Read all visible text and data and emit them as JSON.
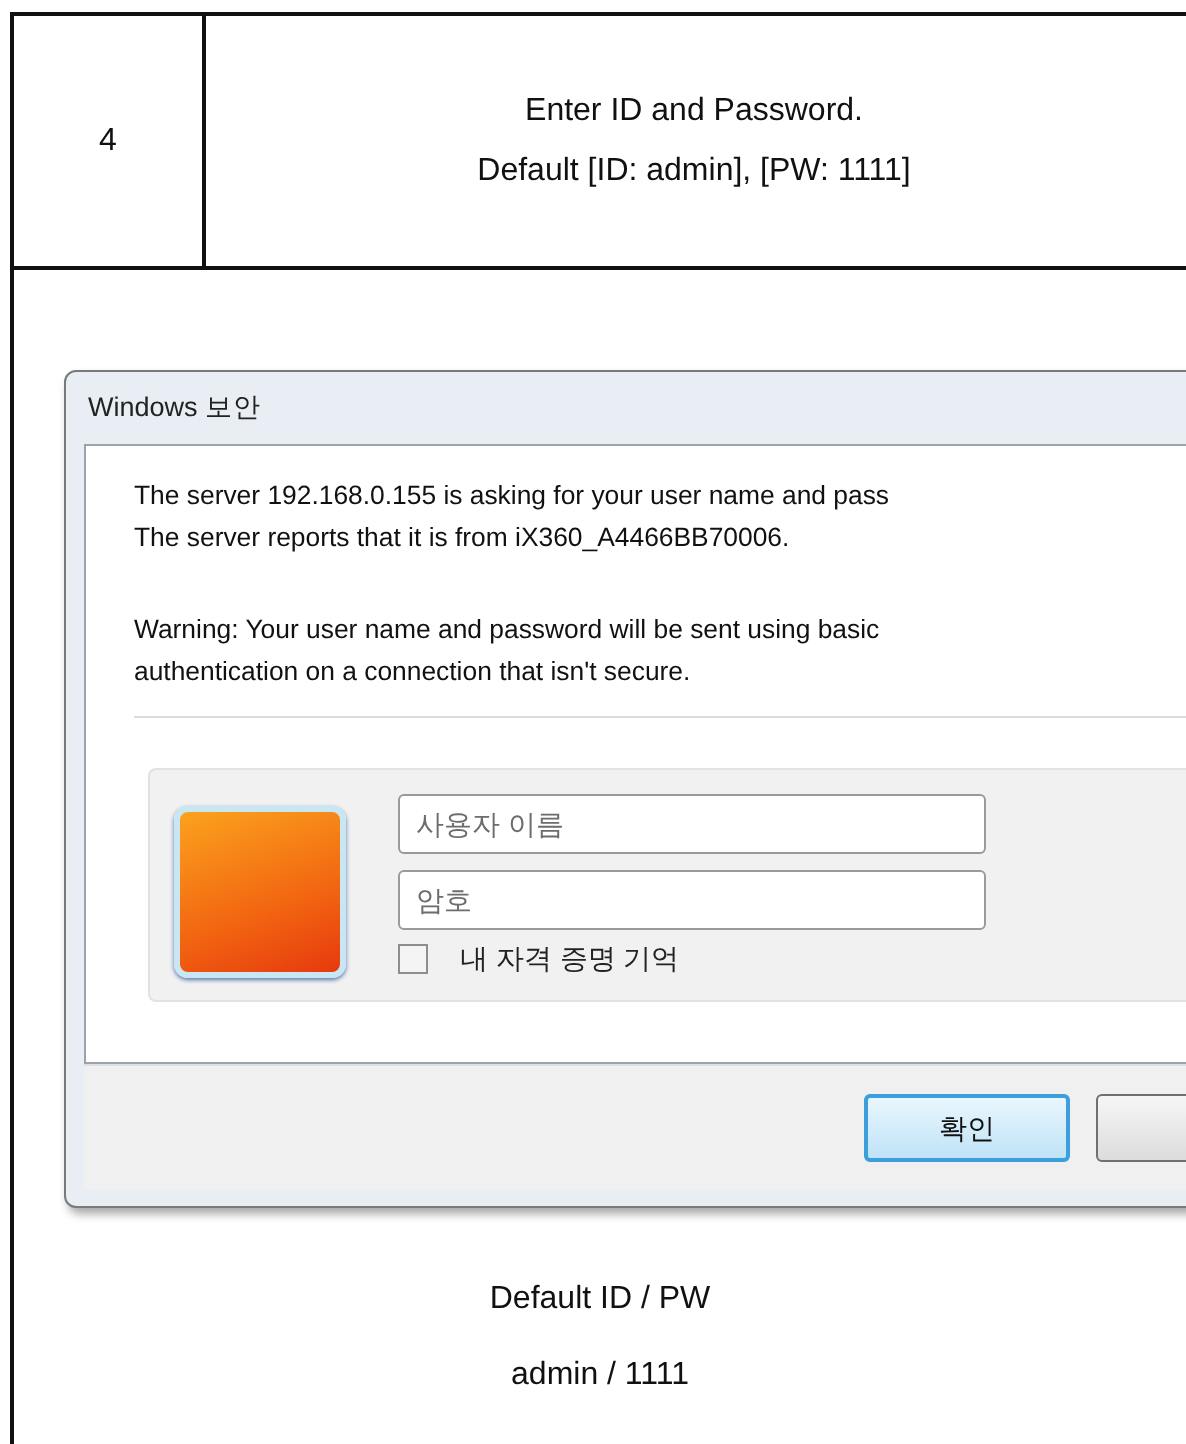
{
  "step_row": {
    "step": "4",
    "instruction_lines": [
      "Enter ID and Password.",
      "Default [ID: admin], [PW: 1111]"
    ]
  },
  "dialog": {
    "title": "Windows 보안",
    "message_lines": [
      "The server 192.168.0.155 is asking for your user name and pass",
      "The server reports that it is from iX360_A4466BB70006."
    ],
    "warning_lines": [
      "Warning: Your user name and password will be sent using basic",
      "authentication on a connection that isn't secure."
    ],
    "username_field": {
      "placeholder": "사용자 이름"
    },
    "password_field": {
      "placeholder": "암호"
    },
    "remember": {
      "label": "내 자격 증명 기억",
      "checked": false
    },
    "buttons": [
      {
        "label": "확인",
        "focused": true
      },
      {
        "focused": false
      }
    ]
  },
  "caption_lines": [
    "Default ID / PW",
    "admin / 1111"
  ]
}
